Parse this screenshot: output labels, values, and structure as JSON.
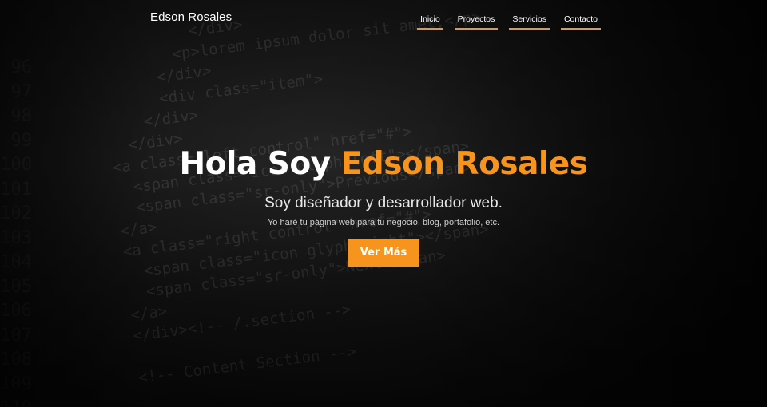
{
  "colors": {
    "accent": "#f7941d",
    "background": "#0b0b0b"
  },
  "nav": {
    "brand": "Edson Rosales",
    "items": [
      {
        "label": "Inicio"
      },
      {
        "label": "Proyectos"
      },
      {
        "label": "Servicios"
      },
      {
        "label": "Contacto"
      }
    ]
  },
  "hero": {
    "title_prefix": "Hola Soy",
    "title_name": "Edson Rosales",
    "subtitle": "Soy diseñador y desarrollador web.",
    "description": "Yo haré tu página web para tu negocio, blog, portafolio, etc.",
    "cta_label": "Ver Más"
  }
}
